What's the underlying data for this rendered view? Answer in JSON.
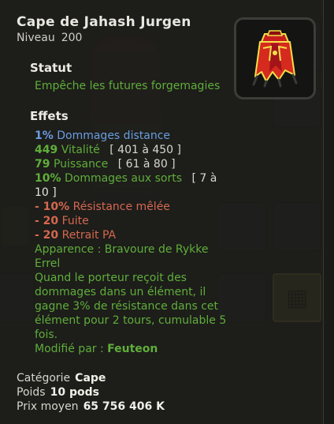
{
  "item": {
    "name": "Cape de Jahash Jurgen",
    "level_label": "Niveau",
    "level_value": "200",
    "icon": "red-cape-icon"
  },
  "status": {
    "heading": "Statut",
    "text": "Empêche les futures forgemagies"
  },
  "effects": {
    "heading": "Effets",
    "lines": [
      {
        "value": "1%",
        "text": "Dommages distance",
        "range": "",
        "color": "#6a9de0"
      },
      {
        "value": "449",
        "text": "Vitalité",
        "range": "[ 401 à 450 ]",
        "color": "#5fae3a"
      },
      {
        "value": "79",
        "text": "Puissance",
        "range": "[ 61 à 80 ]",
        "color": "#5fae3a"
      },
      {
        "value": "10%",
        "text": "Dommages aux sorts",
        "range": "[ 7 à",
        "range_cont": "10 ]",
        "color": "#5fae3a"
      },
      {
        "value": "- 10%",
        "text": "Résistance mêlée",
        "range": "",
        "color": "#d4684f"
      },
      {
        "value": "- 20",
        "text": "Fuite",
        "range": "",
        "color": "#d4684f"
      },
      {
        "value": "- 20",
        "text": "Retrait PA",
        "range": "",
        "color": "#d4684f"
      }
    ],
    "appearance_line1": "Apparence : Bravoure de Rykke",
    "appearance_line2": "Errel",
    "description": [
      "Quand le porteur reçoit des",
      "dommages dans un élément, il",
      "gagne 3% de résistance dans cet",
      "élément pour 2 tours, cumulable 5",
      "fois."
    ],
    "modified_label": "Modifié par :",
    "modified_by": "Feuteon"
  },
  "footer": {
    "category_label": "Catégorie",
    "category_value": "Cape",
    "weight_label": "Poids",
    "weight_value": "10 pods",
    "price_label": "Prix moyen",
    "price_value": "65 756 406 K"
  }
}
